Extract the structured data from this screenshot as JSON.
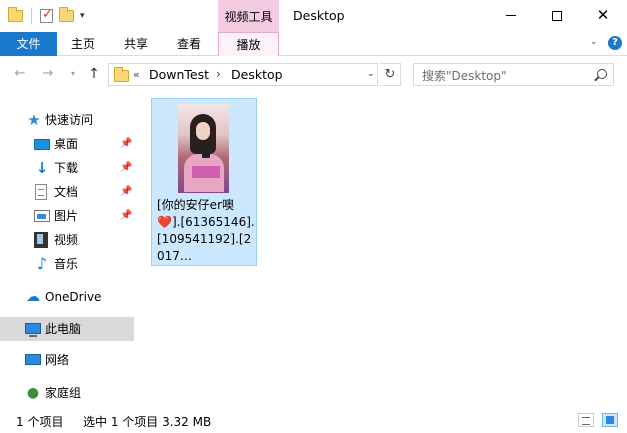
{
  "titlebar": {
    "contextual_tab_group": "视频工具",
    "title": "Desktop",
    "qat_dropdown": "▾"
  },
  "ribbon": {
    "tabs": [
      {
        "label": "文件"
      },
      {
        "label": "主页"
      },
      {
        "label": "共享"
      },
      {
        "label": "查看"
      },
      {
        "label": "播放"
      }
    ],
    "help": "?"
  },
  "address": {
    "overflow": "«",
    "crumbs": [
      "DownTest",
      "Desktop"
    ],
    "separator": "›"
  },
  "search": {
    "placeholder": "搜索\"Desktop\""
  },
  "navpane": {
    "quick_access": "快速访问",
    "quick_items": [
      {
        "label": "桌面",
        "icon": "desktop-icon",
        "pinned": true
      },
      {
        "label": "下载",
        "icon": "download-icon",
        "pinned": true
      },
      {
        "label": "文档",
        "icon": "document-icon",
        "pinned": true
      },
      {
        "label": "图片",
        "icon": "pictures-icon",
        "pinned": true
      },
      {
        "label": "视频",
        "icon": "videos-icon",
        "pinned": false
      },
      {
        "label": "音乐",
        "icon": "music-icon",
        "pinned": false
      }
    ],
    "onedrive": "OneDrive",
    "this_pc": "此电脑",
    "network": "网络",
    "homegroup": "家庭组"
  },
  "content": {
    "files": [
      {
        "name": "[你的安仔er噢❤️].[61365146].[109541192].[2017…",
        "selected": true
      }
    ]
  },
  "statusbar": {
    "item_count": "1 个项目",
    "selection": "选中 1 个项目  3.32 MB"
  },
  "colors": {
    "file_tab": "#1979ca",
    "contextual_tab": "#f3cbe1",
    "selection": "#cce8ff",
    "nav_selected": "#d9d9d9"
  }
}
